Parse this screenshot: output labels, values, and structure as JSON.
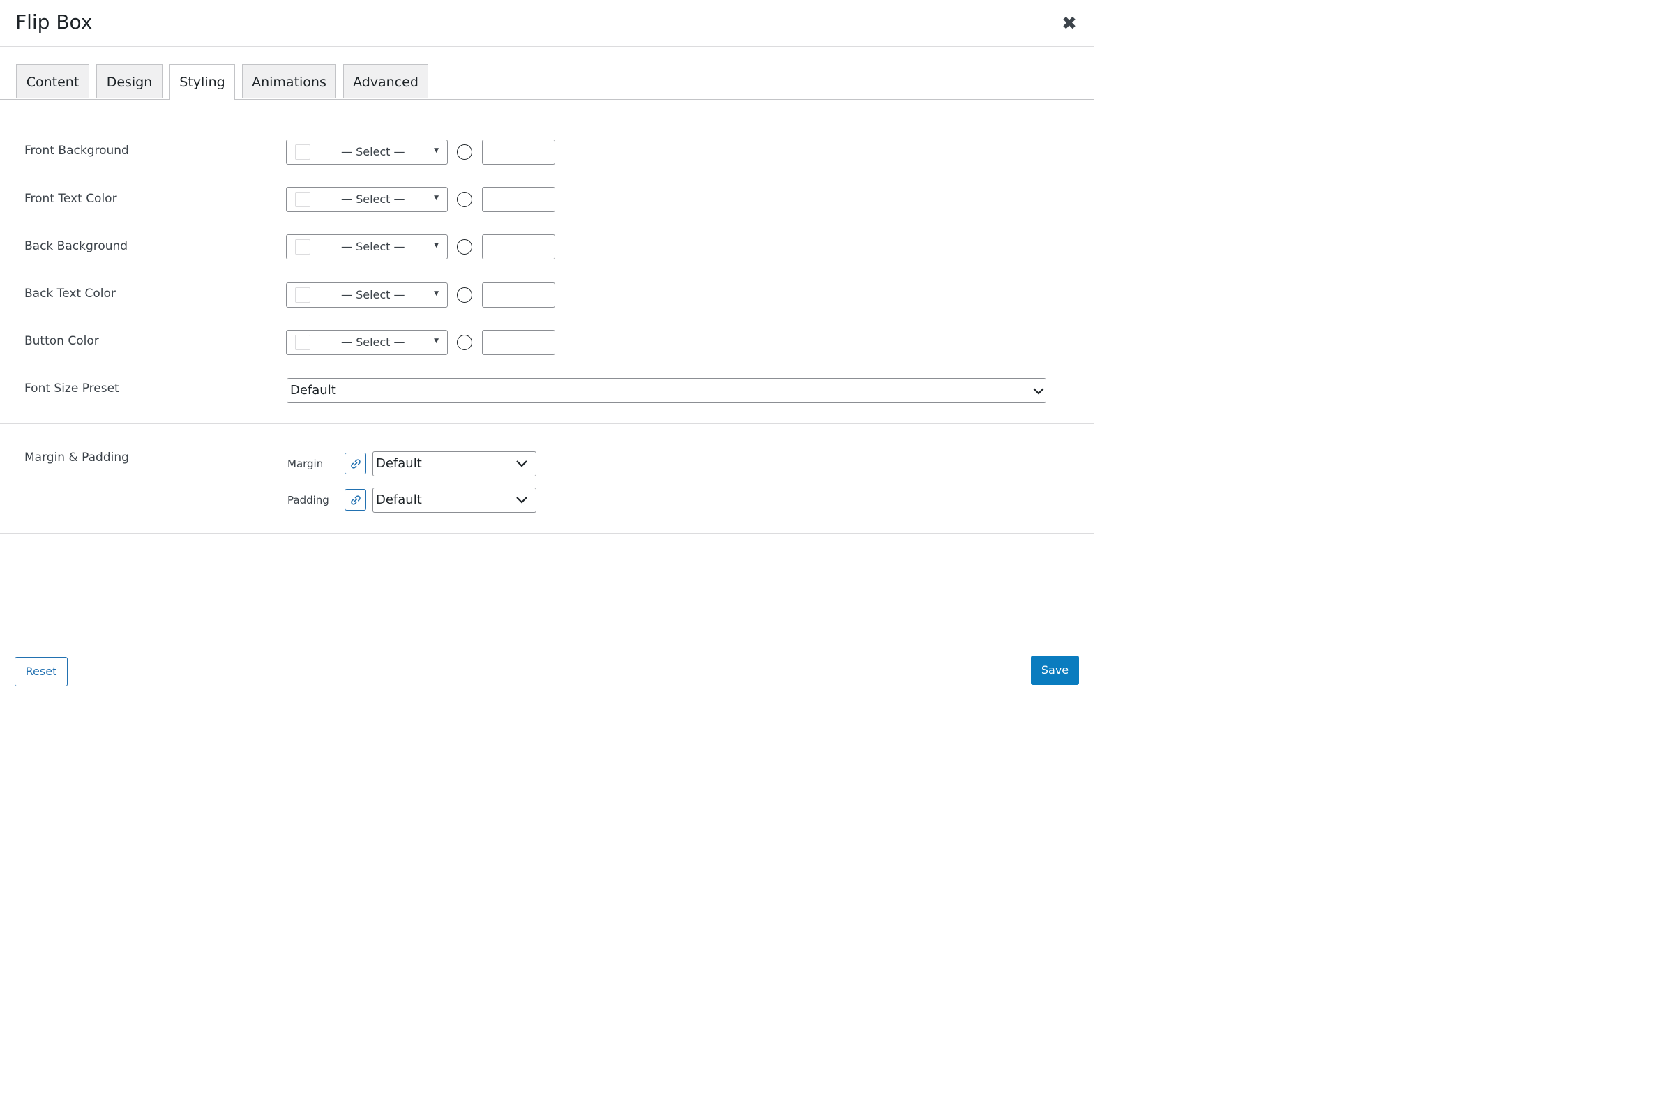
{
  "dialog": {
    "title": "Flip Box",
    "close_icon": "close-icon"
  },
  "tabs": [
    {
      "label": "Content",
      "active": false
    },
    {
      "label": "Design",
      "active": false
    },
    {
      "label": "Styling",
      "active": true
    },
    {
      "label": "Animations",
      "active": false
    },
    {
      "label": "Advanced",
      "active": false
    }
  ],
  "color_fields": [
    {
      "label": "Front Background",
      "select": "— Select —",
      "value": ""
    },
    {
      "label": "Front Text Color",
      "select": "— Select —",
      "value": ""
    },
    {
      "label": "Back Background",
      "select": "— Select —",
      "value": ""
    },
    {
      "label": "Back Text Color",
      "select": "— Select —",
      "value": ""
    },
    {
      "label": "Button Color",
      "select": "— Select —",
      "value": ""
    }
  ],
  "font_size": {
    "label": "Font Size Preset",
    "value": "Default"
  },
  "spacing": {
    "label": "Margin & Padding",
    "margin": {
      "label": "Margin",
      "value": "Default",
      "icon": "link-icon"
    },
    "padding": {
      "label": "Padding",
      "value": "Default",
      "icon": "link-icon"
    }
  },
  "footer": {
    "reset_label": "Reset",
    "save_label": "Save"
  },
  "colors": {
    "primary": "#2271b1",
    "save_bg": "#0a7cbf",
    "border": "#8c8f94"
  }
}
